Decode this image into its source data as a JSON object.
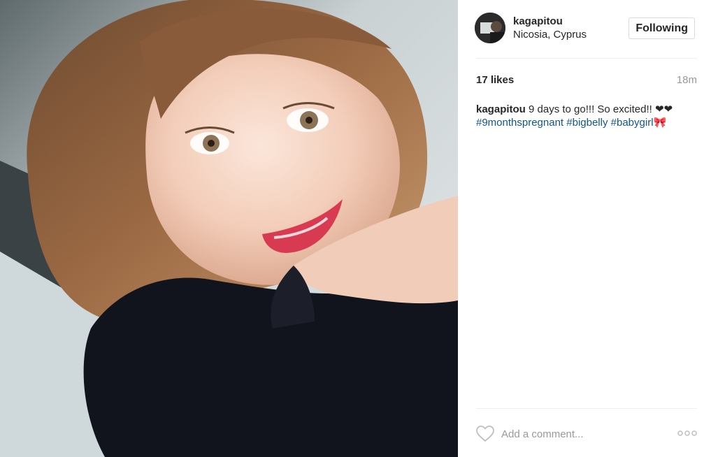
{
  "post": {
    "photo_icon": "selfie-photo",
    "header": {
      "avatar_icon": "user-avatar",
      "username": "kagapitou",
      "location": "Nicosia, Cyprus",
      "follow_label": "Following"
    },
    "stats": {
      "likes": "17 likes",
      "time_ago": "18m"
    },
    "caption": {
      "username": "kagapitou",
      "text": " 9 days to go!!! So excited!! ",
      "emoji": "❤❤",
      "hashtags": [
        "#9monthspregnant",
        "#bigbelly",
        "#babygirl"
      ],
      "trailing_emoji": "🎀"
    },
    "comment": {
      "like_icon": "heart-outline-icon",
      "placeholder": "Add a comment...",
      "more_icon": "more-options-icon"
    },
    "colors": {
      "hashtag": "#125688",
      "muted": "#999999",
      "border": "#dbdbdb",
      "text": "#262626"
    }
  }
}
